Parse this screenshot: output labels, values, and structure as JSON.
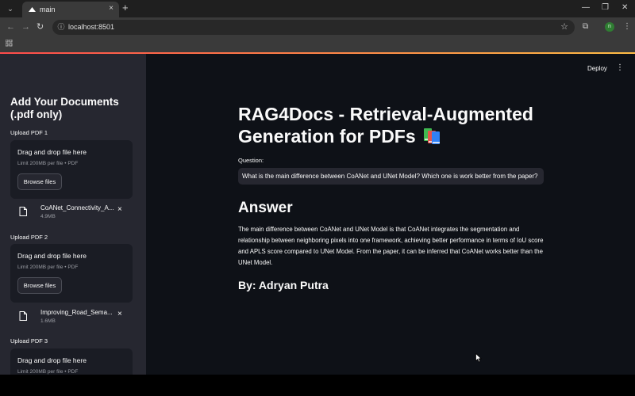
{
  "browser": {
    "tab_title": "main",
    "tab_close": "×",
    "new_tab": "+",
    "url": "localhost:8501",
    "profile_initial": "n",
    "window_controls": [
      "—",
      "❐",
      "✕"
    ]
  },
  "app": {
    "deploy_label": "Deploy",
    "menu_icon": "⋮",
    "title": "RAG4Docs - Retrieval-Augmented Generation for PDFs",
    "question_label": "Question:",
    "question_value": "What is the main difference between CoANet and UNet Model? Which one is work better from the paper?",
    "answer_heading": "Answer",
    "answer_text": "The main difference between CoANet and UNet Model is that CoANet integrates the segmentation and relationship between neighboring pixels into one framework, achieving better performance in terms of IoU score and APLS score compared to UNet Model. From the paper, it can be inferred that CoANet works better than the UNet Model.",
    "byline": "By: Adryan Putra"
  },
  "sidebar": {
    "title": "Add Your Documents (.pdf only)",
    "uploads": [
      {
        "label": "Upload PDF 1",
        "drop_text": "Drag and drop file here",
        "limit_text": "Limit 200MB per file • PDF",
        "browse_label": "Browse files",
        "file_name": "CoANet_Connectivity_A...",
        "file_size": "4.9MB",
        "remove": "×"
      },
      {
        "label": "Upload PDF 2",
        "drop_text": "Drag and drop file here",
        "limit_text": "Limit 200MB per file • PDF",
        "browse_label": "Browse files",
        "file_name": "Improving_Road_Sema...",
        "file_size": "1.6MB",
        "remove": "×"
      },
      {
        "label": "Upload PDF 3",
        "drop_text": "Drag and drop file here",
        "limit_text": "Limit 200MB per file • PDF"
      }
    ]
  },
  "colors": {
    "sidebar_bg": "#262730",
    "main_bg": "#0e1117",
    "accent_red": "#ff4b4b",
    "accent_yellow": "#ffbd45"
  }
}
